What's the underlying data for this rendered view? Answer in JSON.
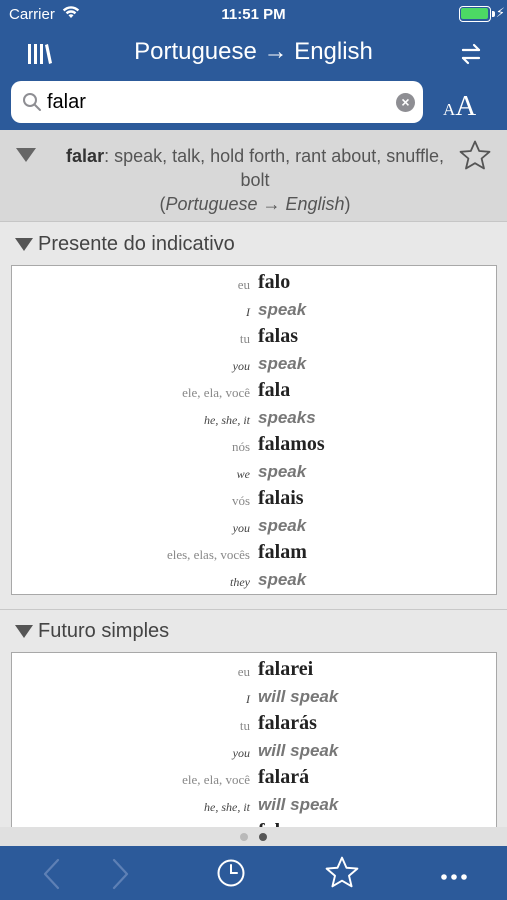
{
  "status": {
    "carrier": "Carrier",
    "time": "11:51 PM"
  },
  "nav": {
    "title": "Portuguese → English"
  },
  "search": {
    "value": "falar",
    "placeholder": ""
  },
  "textsize": {
    "small": "A",
    "big": "A"
  },
  "entry": {
    "headword": "falar",
    "definition": ": speak, talk, hold forth, rant about, snuffle, bolt",
    "lang_open": "(",
    "lang": "Portuguese → English",
    "lang_close": ")"
  },
  "sections": [
    {
      "title": "Presente do indicativo",
      "rows": [
        {
          "pron": "eu",
          "form": "falo",
          "pron_en": "I",
          "trans": "speak"
        },
        {
          "pron": "tu",
          "form": "falas",
          "pron_en": "you",
          "trans": "speak"
        },
        {
          "pron": "ele, ela, você",
          "form": "fala",
          "pron_en": "he, she, it",
          "trans": "speaks"
        },
        {
          "pron": "nós",
          "form": "falamos",
          "pron_en": "we",
          "trans": "speak"
        },
        {
          "pron": "vós",
          "form": "falais",
          "pron_en": "you",
          "trans": "speak"
        },
        {
          "pron": "eles, elas, vocês",
          "form": "falam",
          "pron_en": "they",
          "trans": "speak"
        }
      ]
    },
    {
      "title": "Futuro simples",
      "rows": [
        {
          "pron": "eu",
          "form": "falarei",
          "pron_en": "I",
          "trans": "will speak"
        },
        {
          "pron": "tu",
          "form": "falarás",
          "pron_en": "you",
          "trans": "will speak"
        },
        {
          "pron": "ele, ela, você",
          "form": "falará",
          "pron_en": "he, she, it",
          "trans": "will speak"
        },
        {
          "pron": "",
          "form": "falaremos",
          "pron_en": "",
          "trans": ""
        }
      ]
    }
  ],
  "pager": {
    "count": 2,
    "active": 2
  },
  "toolbar": {
    "icons": [
      "back-arrow-icon",
      "forward-arrow-icon",
      "history-clock-icon",
      "favorites-star-icon",
      "more-ellipsis-icon"
    ]
  },
  "colors": {
    "bar": "#2c5a9a",
    "battery": "#4cd964"
  }
}
